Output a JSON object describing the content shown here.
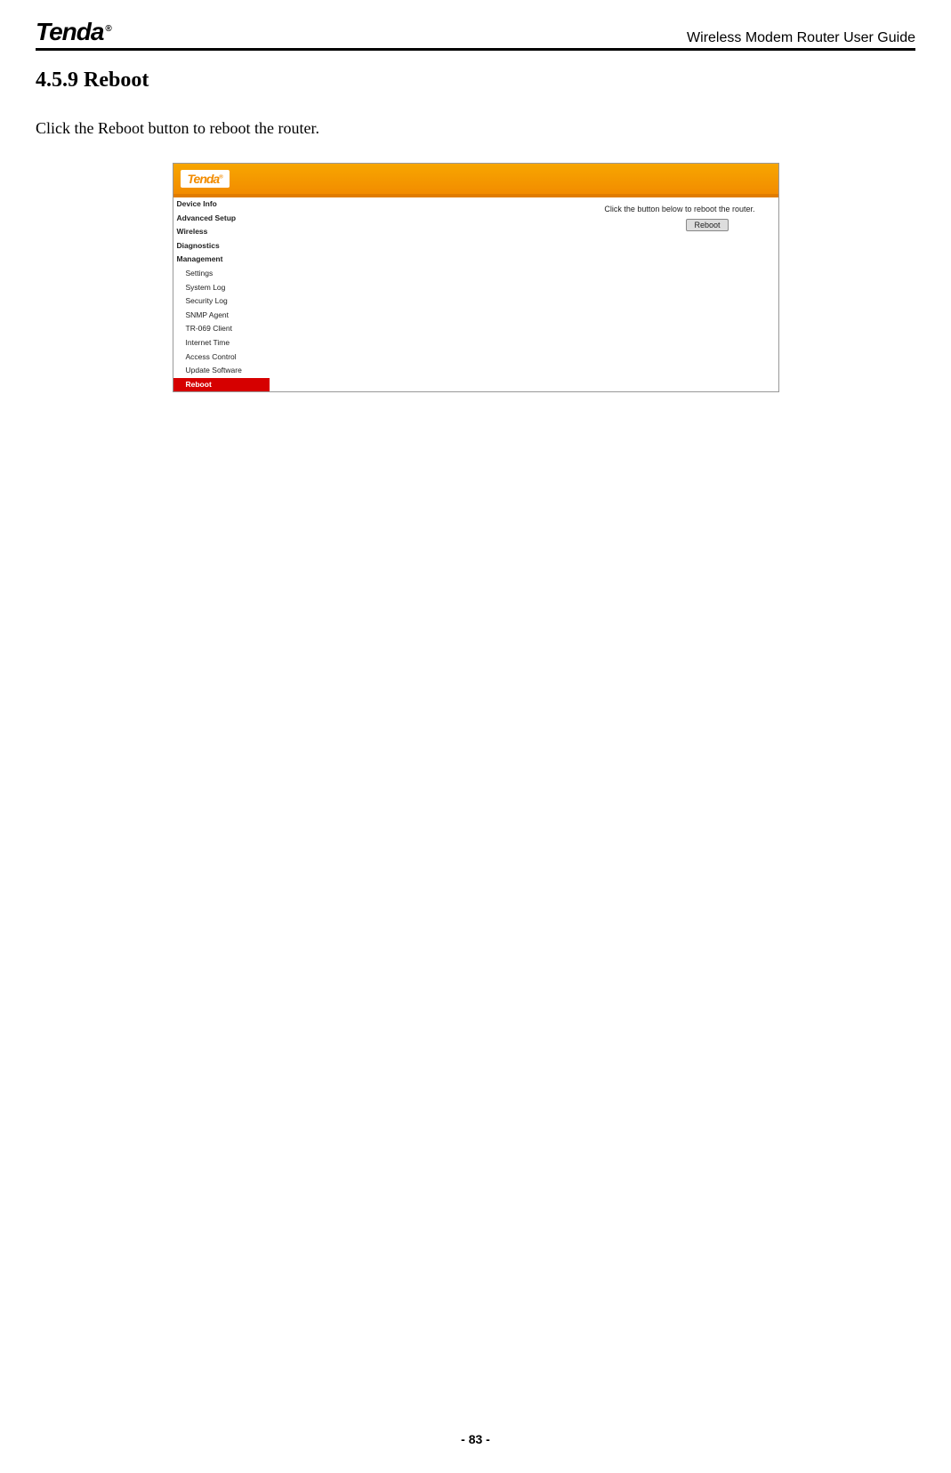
{
  "header": {
    "logo_text": "Tenda",
    "logo_reg": "®",
    "doc_title": "Wireless Modem Router User Guide"
  },
  "section": {
    "number_title": "4.5.9 Reboot",
    "body": "Click the Reboot button to reboot the router."
  },
  "screenshot": {
    "banner_logo": "Tenda",
    "banner_reg": "®",
    "sidebar": {
      "device_info": "Device Info",
      "advanced_setup": "Advanced Setup",
      "wireless": "Wireless",
      "diagnostics": "Diagnostics",
      "management": "Management",
      "sub": {
        "settings": "Settings",
        "system_log": "System Log",
        "security_log": "Security Log",
        "snmp_agent": "SNMP Agent",
        "tr069": "TR-069 Client",
        "internet_time": "Internet Time",
        "access_control": "Access Control",
        "update_software": "Update Software",
        "reboot": "Reboot"
      }
    },
    "main": {
      "instruction": "Click the button below to reboot the router.",
      "reboot_button": "Reboot"
    }
  },
  "footer": {
    "page_number": "- 83 -"
  }
}
